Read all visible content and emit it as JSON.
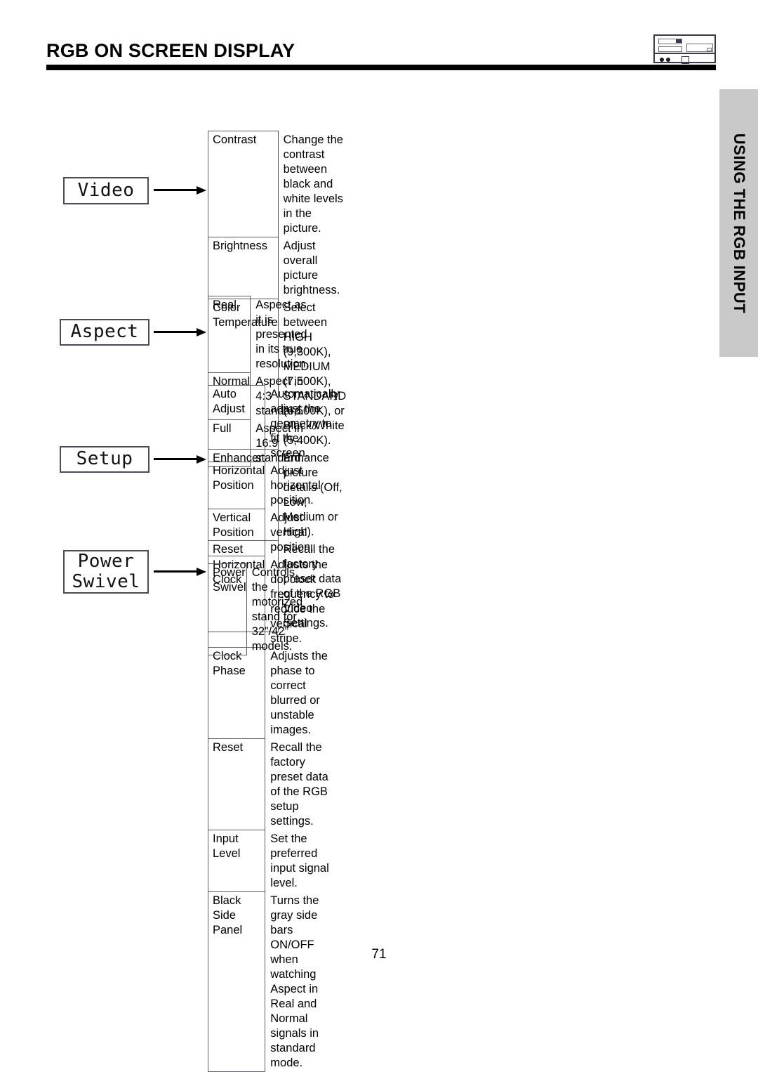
{
  "header": {
    "title": "RGB ON SCREEN DISPLAY",
    "device_icon": "tv-device-icon"
  },
  "side_tab": {
    "label": "USING THE RGB INPUT",
    "color": "#c9c9c9"
  },
  "sections": [
    {
      "id": "video",
      "button_label": "Video",
      "rows": [
        {
          "name": "Contrast",
          "desc": "Change the contrast between black and white levels in the\npicture.",
          "tall": true
        },
        {
          "name": "Brightness",
          "desc": "Adjust overall picture brightness.",
          "tall": false
        },
        {
          "name": "Color Temperature",
          "desc": "Select between HIGH (9,300K), MEDIUM (7,500K),\nSTANDARD (6,500K), or Black/White (5,400K).",
          "tall": true
        },
        {
          "name": "Enhancer",
          "desc": "Enhance picture details (Off, Low, Medium or High).",
          "tall": false
        },
        {
          "name": "Reset",
          "desc": "Recall the factory preset data of the RGB Video Settings.",
          "tall": false
        }
      ]
    },
    {
      "id": "aspect",
      "button_label": "Aspect",
      "rows": [
        {
          "name": "Real",
          "desc": "Aspect as it is presented in its true resolution.",
          "tall": false
        },
        {
          "name": "Normal",
          "desc": "Aspect in 4:3 standard.",
          "tall": false
        },
        {
          "name": "Full",
          "desc": "Aspect in 16:9 standard.",
          "tall": false
        }
      ]
    },
    {
      "id": "setup",
      "button_label": "Setup",
      "rows": [
        {
          "name": "Auto Adjust",
          "desc": "Automatically adjust the geometry to fit the screen.",
          "tall": false
        },
        {
          "name": "Horizontal Position",
          "desc": "Adjust horizontal position.",
          "tall": false
        },
        {
          "name": "Vertical Position",
          "desc": "Adjust vertical position.",
          "tall": false
        },
        {
          "name": "Horizontal Clock",
          "desc": "Adjusts the dot clock frequency to reduce the vertical stripe.",
          "tall": false
        },
        {
          "name": "Clock Phase",
          "desc": "Adjusts the phase to correct blurred or unstable images.",
          "tall": false
        },
        {
          "name": "Reset",
          "desc": "Recall the factory preset data of the RGB setup settings.",
          "tall": false
        },
        {
          "name": "Input Level",
          "desc": "Set the preferred input signal level.",
          "tall": false
        },
        {
          "name": "Black Side Panel",
          "desc": "Turns the gray side bars ON/OFF when watching Aspect in\nReal and Normal signals in standard mode.",
          "tall": true
        }
      ]
    },
    {
      "id": "power-swivel",
      "button_label": "Power\nSwivel",
      "rows": [
        {
          "name": "Power Swivel",
          "desc": "Controls the motorized stand for 32”/42” models.",
          "tall": false
        }
      ]
    }
  ],
  "footer": {
    "page_number": "71"
  }
}
